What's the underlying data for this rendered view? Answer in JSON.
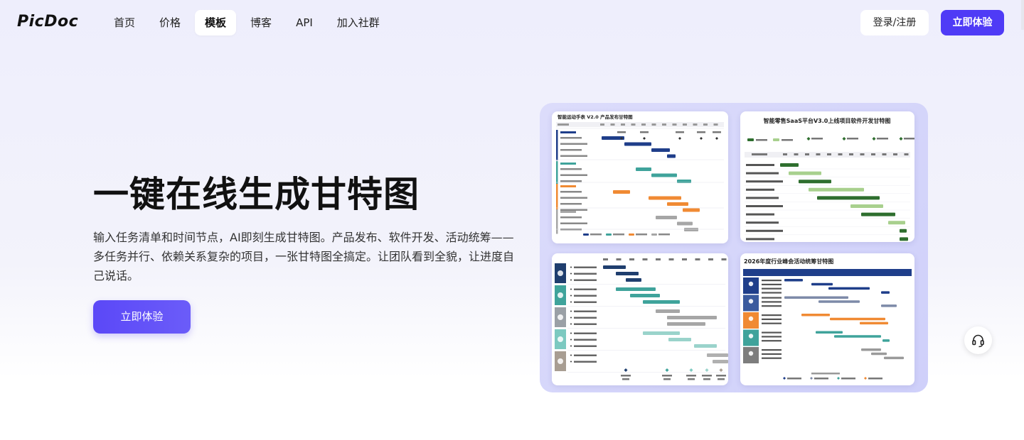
{
  "brand": {
    "logo": "PicDoc"
  },
  "nav": {
    "links": [
      {
        "label": "首页"
      },
      {
        "label": "价格"
      },
      {
        "label": "模板"
      },
      {
        "label": "博客"
      },
      {
        "label": "API"
      },
      {
        "label": "加入社群"
      }
    ],
    "active": "模板",
    "login_label": "登录/注册",
    "try_label": "立即体验"
  },
  "hero": {
    "title": "一键在线生成甘特图",
    "description": "输入任务清单和时间节点，AI即刻生成甘特图。产品发布、软件开发、活动统筹——多任务并行、依赖关系复杂的项目，一张甘特图全搞定。让团队看到全貌，让进度自己说话。",
    "cta_label": "立即体验"
  },
  "templates": [
    {
      "title": "智能运动手表 V2.0 产品发布甘特图"
    },
    {
      "title": "智能零售SaaS平台V3.0上线项目软件开发甘特图"
    },
    {
      "title": ""
    },
    {
      "title": "2026年度行业峰会活动统筹甘特图"
    }
  ],
  "colors": {
    "accent": "#4f3bf6",
    "navy": "#1f3e8a",
    "teal": "#3fa39b",
    "orange": "#f08a33",
    "green_dark": "#2e6e2e",
    "green_light": "#a8d08d",
    "gray": "#a6a6a6"
  },
  "icons": {
    "help": "headset-icon"
  }
}
